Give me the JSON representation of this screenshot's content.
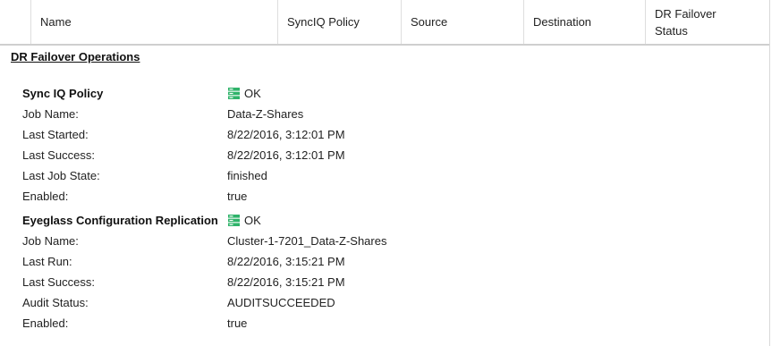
{
  "table": {
    "columns": {
      "name": "Name",
      "synciq_policy": "SyncIQ Policy",
      "source": "Source",
      "destination": "Destination",
      "dr_failover_status": "DR Failover Status"
    }
  },
  "dr_section": {
    "title": "DR Failover Operations",
    "sync_iq_policy": {
      "heading": "Sync IQ Policy",
      "status_text": "OK",
      "status_icon": "green-server-ok-icon",
      "status_color": "#2fb36a",
      "fields": [
        {
          "label": "Job Name:",
          "value": "Data-Z-Shares"
        },
        {
          "label": "Last Started:",
          "value": "8/22/2016, 3:12:01 PM"
        },
        {
          "label": "Last Success:",
          "value": "8/22/2016, 3:12:01 PM"
        },
        {
          "label": "Last Job State:",
          "value": "finished"
        },
        {
          "label": "Enabled:",
          "value": "true"
        }
      ]
    },
    "eyeglass_replication": {
      "heading": "Eyeglass Configuration Replication",
      "status_text": "OK",
      "status_icon": "green-server-ok-icon",
      "status_color": "#2fb36a",
      "fields": [
        {
          "label": "Job Name:",
          "value": "Cluster-1-7201_Data-Z-Shares"
        },
        {
          "label": "Last Run:",
          "value": "8/22/2016, 3:15:21 PM"
        },
        {
          "label": "Last Success:",
          "value": "8/22/2016, 3:15:21 PM"
        },
        {
          "label": "Audit Status:",
          "value": "AUDITSUCCEEDED"
        },
        {
          "label": "Enabled:",
          "value": "true"
        }
      ]
    }
  }
}
